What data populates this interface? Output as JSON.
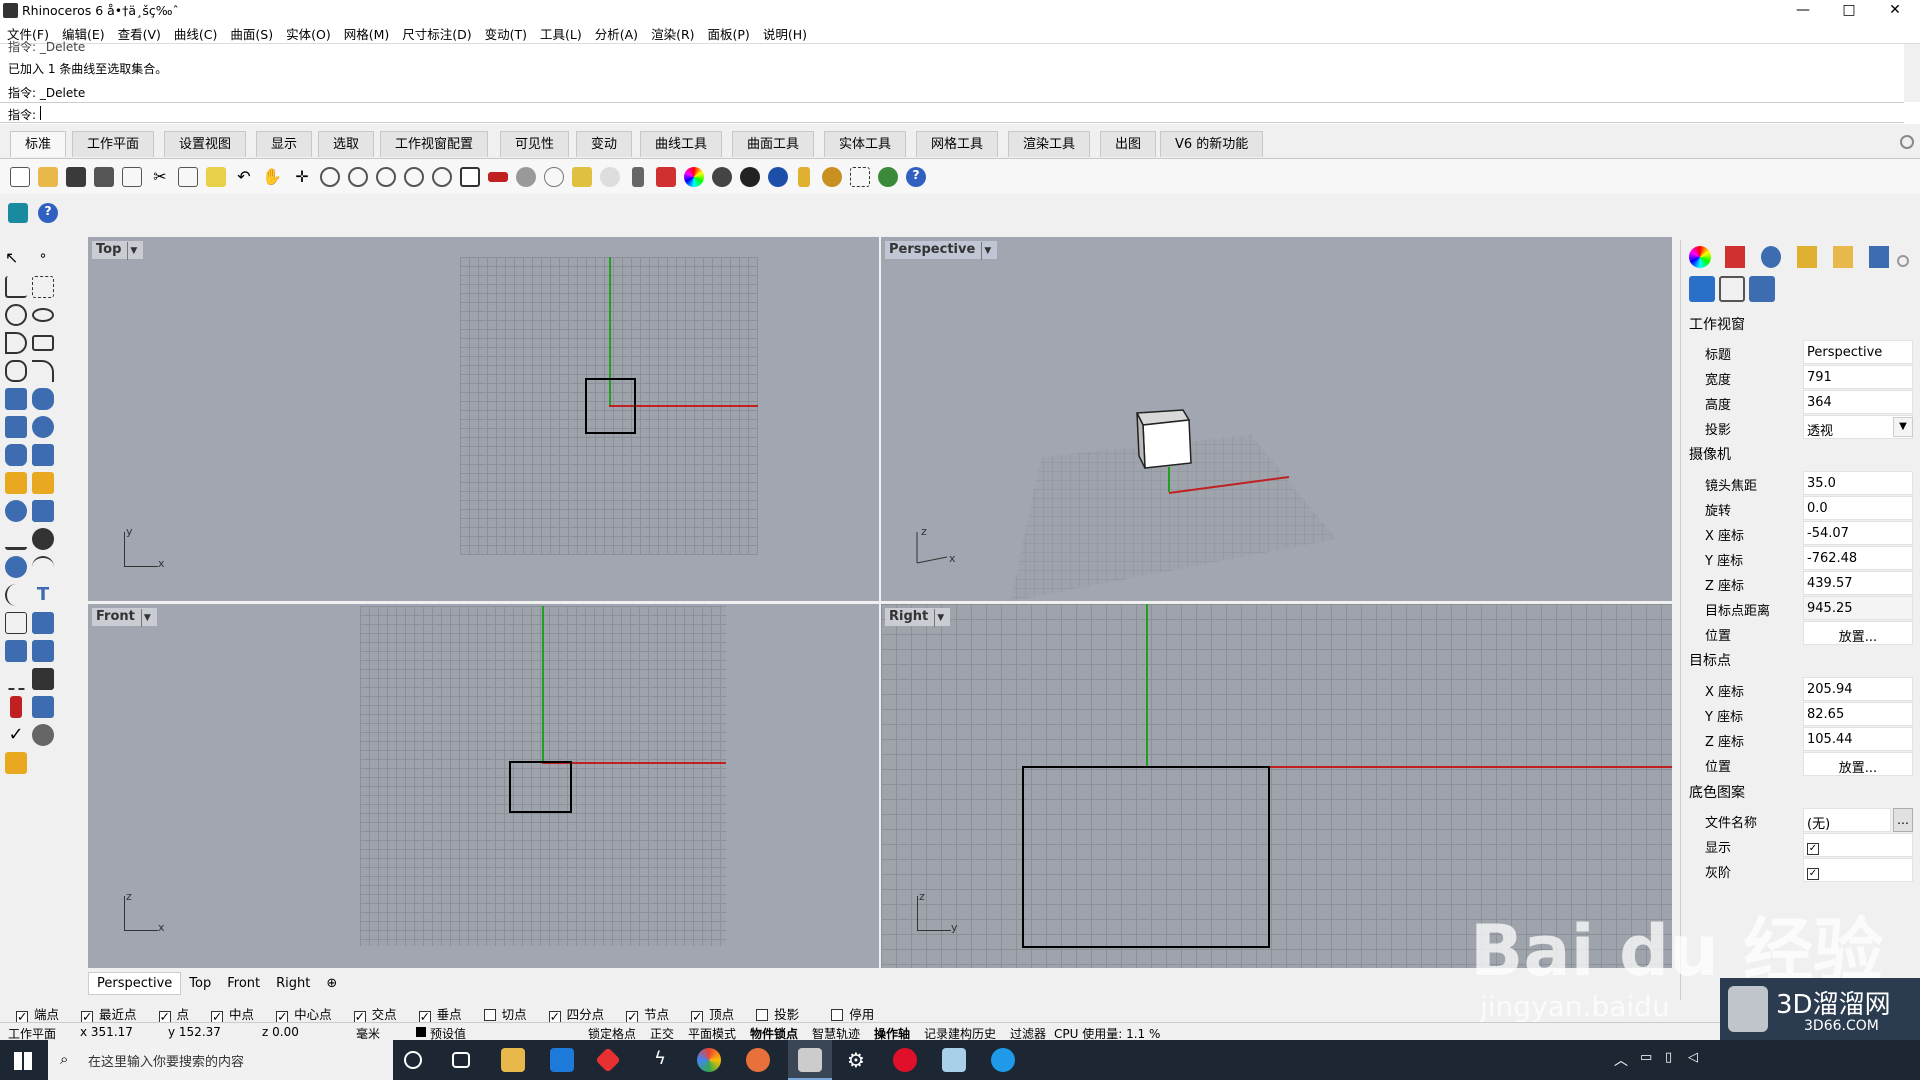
{
  "window": {
    "title": "Rhinoceros 6 å•†ä¸šç‰ˆ",
    "controls": [
      "—",
      "□",
      "✕"
    ]
  },
  "menu": [
    "文件(F)",
    "编辑(E)",
    "查看(V)",
    "曲线(C)",
    "曲面(S)",
    "实体(O)",
    "网格(M)",
    "尺寸标注(D)",
    "变动(T)",
    "工具(L)",
    "分析(A)",
    "渲染(R)",
    "面板(P)",
    "说明(H)"
  ],
  "command_history": [
    "指令: _Delete",
    "已加入 1 条曲线至选取集合。",
    "指令: _Delete"
  ],
  "command_prompt": "指令:",
  "toolbar_tabs": [
    "标准",
    "工作平面",
    "设置视图",
    "显示",
    "选取",
    "工作视窗配置",
    "可见性",
    "变动",
    "曲线工具",
    "曲面工具",
    "实体工具",
    "网格工具",
    "渲染工具",
    "出图",
    "V6 的新功能"
  ],
  "viewports": {
    "top": "Top",
    "perspective": "Perspective",
    "front": "Front",
    "right": "Right"
  },
  "axis_labels": {
    "x": "x",
    "y": "y",
    "z": "z"
  },
  "viewport_tabs": [
    "Perspective",
    "Top",
    "Front",
    "Right"
  ],
  "panel": {
    "section_viewport": "工作视窗",
    "title_k": "标题",
    "title_v": "Perspective",
    "width_k": "宽度",
    "width_v": "791",
    "height_k": "高度",
    "height_v": "364",
    "proj_k": "投影",
    "proj_v": "透视",
    "section_camera": "摄像机",
    "lens_k": "镜头焦距",
    "lens_v": "35.0",
    "rot_k": "旋转",
    "rot_v": "0.0",
    "cx_k": "X 座标",
    "cx_v": "-54.07",
    "cy_k": "Y 座标",
    "cy_v": "-762.48",
    "cz_k": "Z 座标",
    "cz_v": "439.57",
    "dist_k": "目标点距离",
    "dist_v": "945.25",
    "pos_k": "位置",
    "place_btn": "放置...",
    "section_target": "目标点",
    "tx_k": "X 座标",
    "tx_v": "205.94",
    "ty_k": "Y 座标",
    "ty_v": "82.65",
    "tz_k": "Z 座标",
    "tz_v": "105.44",
    "tpos_k": "位置",
    "tplace_btn": "放置...",
    "section_bg": "底色图案",
    "file_k": "文件名称",
    "file_v": "(无)",
    "file_btn": "...",
    "show_k": "显示",
    "gray_k": "灰阶"
  },
  "osnaps": [
    {
      "label": "端点",
      "checked": true
    },
    {
      "label": "最近点",
      "checked": true
    },
    {
      "label": "点",
      "checked": true
    },
    {
      "label": "中点",
      "checked": true
    },
    {
      "label": "中心点",
      "checked": true
    },
    {
      "label": "交点",
      "checked": true
    },
    {
      "label": "垂点",
      "checked": true
    },
    {
      "label": "切点",
      "checked": false
    },
    {
      "label": "四分点",
      "checked": true
    },
    {
      "label": "节点",
      "checked": true
    },
    {
      "label": "顶点",
      "checked": true
    },
    {
      "label": "投影",
      "checked": false
    },
    {
      "label": "停用",
      "checked": false
    }
  ],
  "status": {
    "cplane": "工作平面",
    "x": "x 351.17",
    "y": "y 152.37",
    "z": "z 0.00",
    "unit": "毫米",
    "layer": "预设值",
    "toggles": [
      "锁定格点",
      "正交",
      "平面模式",
      "物件锁点",
      "智慧轨迹",
      "操作轴",
      "记录建构历史",
      "过滤器"
    ],
    "cpu": "CPU 使用量: 1.1 %"
  },
  "taskbar": {
    "search_placeholder": "在这里输入你要搜索的内容"
  },
  "watermark": {
    "baidu": "Bai du 经验",
    "jingyan": "jingyan.baidu",
    "site": "3D溜溜网",
    "site_url": "3D66.COM"
  },
  "colors": {
    "viewport_bg": "#a1a6b0",
    "x_axis": "#c02020",
    "y_axis": "#20a020",
    "taskbar": "#1d2733"
  }
}
